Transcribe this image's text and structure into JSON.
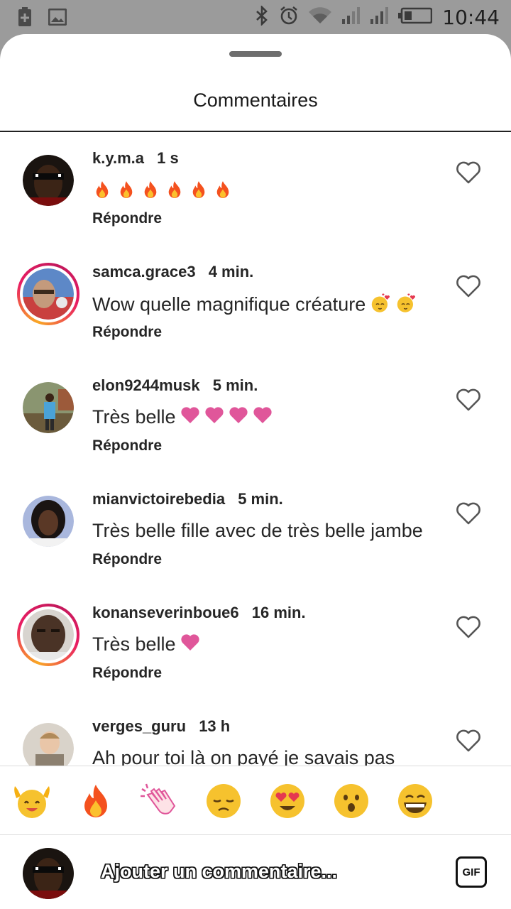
{
  "status_bar": {
    "time": "10:44",
    "icons": [
      "add-icon",
      "image-icon",
      "bluetooth-icon",
      "alarm-icon",
      "wifi-icon",
      "signal-icon",
      "signal-icon",
      "battery-icon"
    ]
  },
  "sheet": {
    "title": "Commentaires"
  },
  "comments": [
    {
      "user": "k.y.m.a",
      "time": "1 s",
      "text": "",
      "emoji": [
        "fire",
        "fire",
        "fire",
        "fire",
        "fire",
        "fire"
      ],
      "reply": "Répondre",
      "ring": false,
      "avatar_color": "#2b1d14"
    },
    {
      "user": "samca.grace3",
      "time": "4 min.",
      "text": "Wow quelle magnifique créature",
      "emoji": [
        "hearts-face",
        "hearts-face"
      ],
      "reply": "Répondre",
      "ring": true,
      "avatar_color": "#b9786a"
    },
    {
      "user": "elon9244musk",
      "time": "5 min.",
      "text": "Très belle",
      "emoji": [
        "pink-heart",
        "pink-heart",
        "pink-heart",
        "pink-heart"
      ],
      "reply": "Répondre",
      "ring": false,
      "avatar_color": "#6f7b5a"
    },
    {
      "user": "mianvictoirebedia",
      "time": "5 min.",
      "text": "Très belle fille avec de très belle jambe",
      "emoji": [],
      "reply": "Répondre",
      "ring": false,
      "avatar_color": "#3a2c2a"
    },
    {
      "user": "konanseverinboue6",
      "time": "16 min.",
      "text": "Très belle",
      "emoji": [
        "pink-heart"
      ],
      "reply": "Répondre",
      "ring": true,
      "avatar_color": "#4a3326"
    },
    {
      "user": "verges_guru",
      "time": "13 h",
      "text": "Ah pour toi là on payé je savais pas",
      "emoji": [],
      "reply": "Répondre",
      "ring": false,
      "avatar_color": "#a89a86"
    }
  ],
  "emoji_bar": [
    "raising-hands",
    "fire",
    "clapping-hands",
    "sad-face",
    "heart-eyes",
    "surprised-face",
    "grinning-face"
  ],
  "composer": {
    "placeholder": "Ajouter un commentaire...",
    "gif_label": "GIF"
  },
  "colors": {
    "heart_pink": "#e0569a",
    "ring_orange": "#f9a825",
    "ring_pink": "#e91e63",
    "emoji_yellow": "#f6c22e"
  }
}
